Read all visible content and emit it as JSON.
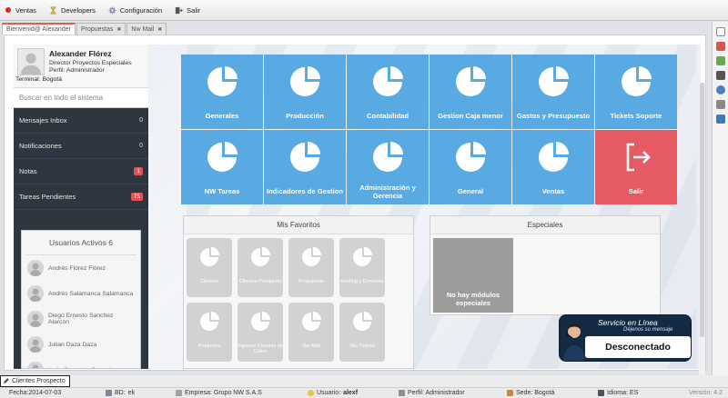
{
  "menu": {
    "items": [
      {
        "label": "Ventas",
        "icon": "red-dot-icon"
      },
      {
        "label": "Developers",
        "icon": "hourglass-icon"
      },
      {
        "label": "Configuración",
        "icon": "gear-icon"
      },
      {
        "label": "Salir",
        "icon": "exit-icon"
      }
    ]
  },
  "tabs": [
    {
      "label": "Bienvenid@ Alexander",
      "active": true
    },
    {
      "label": "Propuestas",
      "active": false
    },
    {
      "label": "Nw Mail",
      "active": false
    }
  ],
  "profile": {
    "name": "Alexander Flórez",
    "role": "Director Proyectos Especiales",
    "perfil": "Perfil: Administrador",
    "terminal": "Terminal: Bogotá"
  },
  "search": {
    "placeholder": "Buscar en todo el sistema"
  },
  "sidebar_items": [
    {
      "label": "Mensajes Inbox",
      "count": "0",
      "style": "gray"
    },
    {
      "label": "Notificaciones",
      "count": "0",
      "style": "gray"
    },
    {
      "label": "Notas",
      "count": "1",
      "style": "red"
    },
    {
      "label": "Tareas Pendientes",
      "count": "75",
      "style": "red"
    }
  ],
  "users": {
    "title": "Usuarios Activos 6",
    "list": [
      "Andrés Flórez Flórez",
      "Andrés Salamanca Salamanca",
      "Diego Ernesto Sanchez Alarcon",
      "Julian Daza Daza",
      "Lady Gonzalez Gonzalez"
    ]
  },
  "tiles": [
    {
      "label": "Generales",
      "icon": "pie-chart-icon"
    },
    {
      "label": "Producción",
      "icon": "pie-chart-icon"
    },
    {
      "label": "Contabilidad",
      "icon": "pie-chart-icon"
    },
    {
      "label": "Gestion Caja menor",
      "icon": "pie-chart-icon"
    },
    {
      "label": "Gastos y Presupuesto",
      "icon": "pie-chart-icon"
    },
    {
      "label": "Tickets Soporte",
      "icon": "pie-chart-icon"
    },
    {
      "label": "NW Tareas",
      "icon": "pie-chart-icon"
    },
    {
      "label": "Indicadores de Gestion",
      "icon": "pie-chart-icon"
    },
    {
      "label": "Administración y Gerencia",
      "icon": "pie-chart-icon"
    },
    {
      "label": "General",
      "icon": "pie-chart-icon"
    },
    {
      "label": "Ventas",
      "icon": "pie-chart-icon"
    },
    {
      "label": "Salir",
      "icon": "logout-icon"
    }
  ],
  "favorites": {
    "title": "Mis Favoritos",
    "items": [
      "Clientes",
      "Clientes Prospecto",
      "Propuestas",
      "Hosting y Dominios",
      "Productos",
      "Ingresar Cuentas de Cobro",
      "Nw Mail",
      "Mis Tickets"
    ]
  },
  "especiales": {
    "title": "Especiales",
    "empty": "No hay módulos especiales"
  },
  "chat": {
    "title": "Servicio en Línea",
    "subtitle": "Déjenos su mensaje",
    "status": "Desconectado"
  },
  "taskbar": {
    "button": "Clientes Prospecto"
  },
  "statusbar": {
    "fecha": "Fecha:2014-07-03",
    "bd_label": "BD:",
    "bd_value": "ek",
    "empresa": "Empresa: Grupo NW S.A.S",
    "usuario_label": "Usuario:",
    "usuario_value": "alexf",
    "perfil": "Perfil: Administrador",
    "sede": "Sede: Bogotá",
    "idioma": "Idioma: ES",
    "version": "Versión: 4.2"
  },
  "colors": {
    "tile_blue": "#59a9e2",
    "tile_red": "#e65a63",
    "sidebar_dark": "#2e3640",
    "badge_red": "#e05555"
  }
}
